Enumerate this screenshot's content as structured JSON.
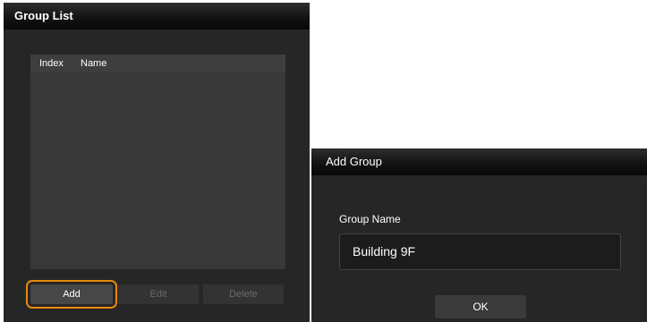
{
  "group_list": {
    "title": "Group List",
    "columns": [
      "Index",
      "Name"
    ],
    "rows": [],
    "buttons": {
      "add": "Add",
      "edit": "Edit",
      "delete": "Delete"
    },
    "highlight_color": "#e8890c"
  },
  "add_group": {
    "title": "Add Group",
    "field_label": "Group Name",
    "field_value": "Building 9F",
    "ok_label": "OK"
  }
}
